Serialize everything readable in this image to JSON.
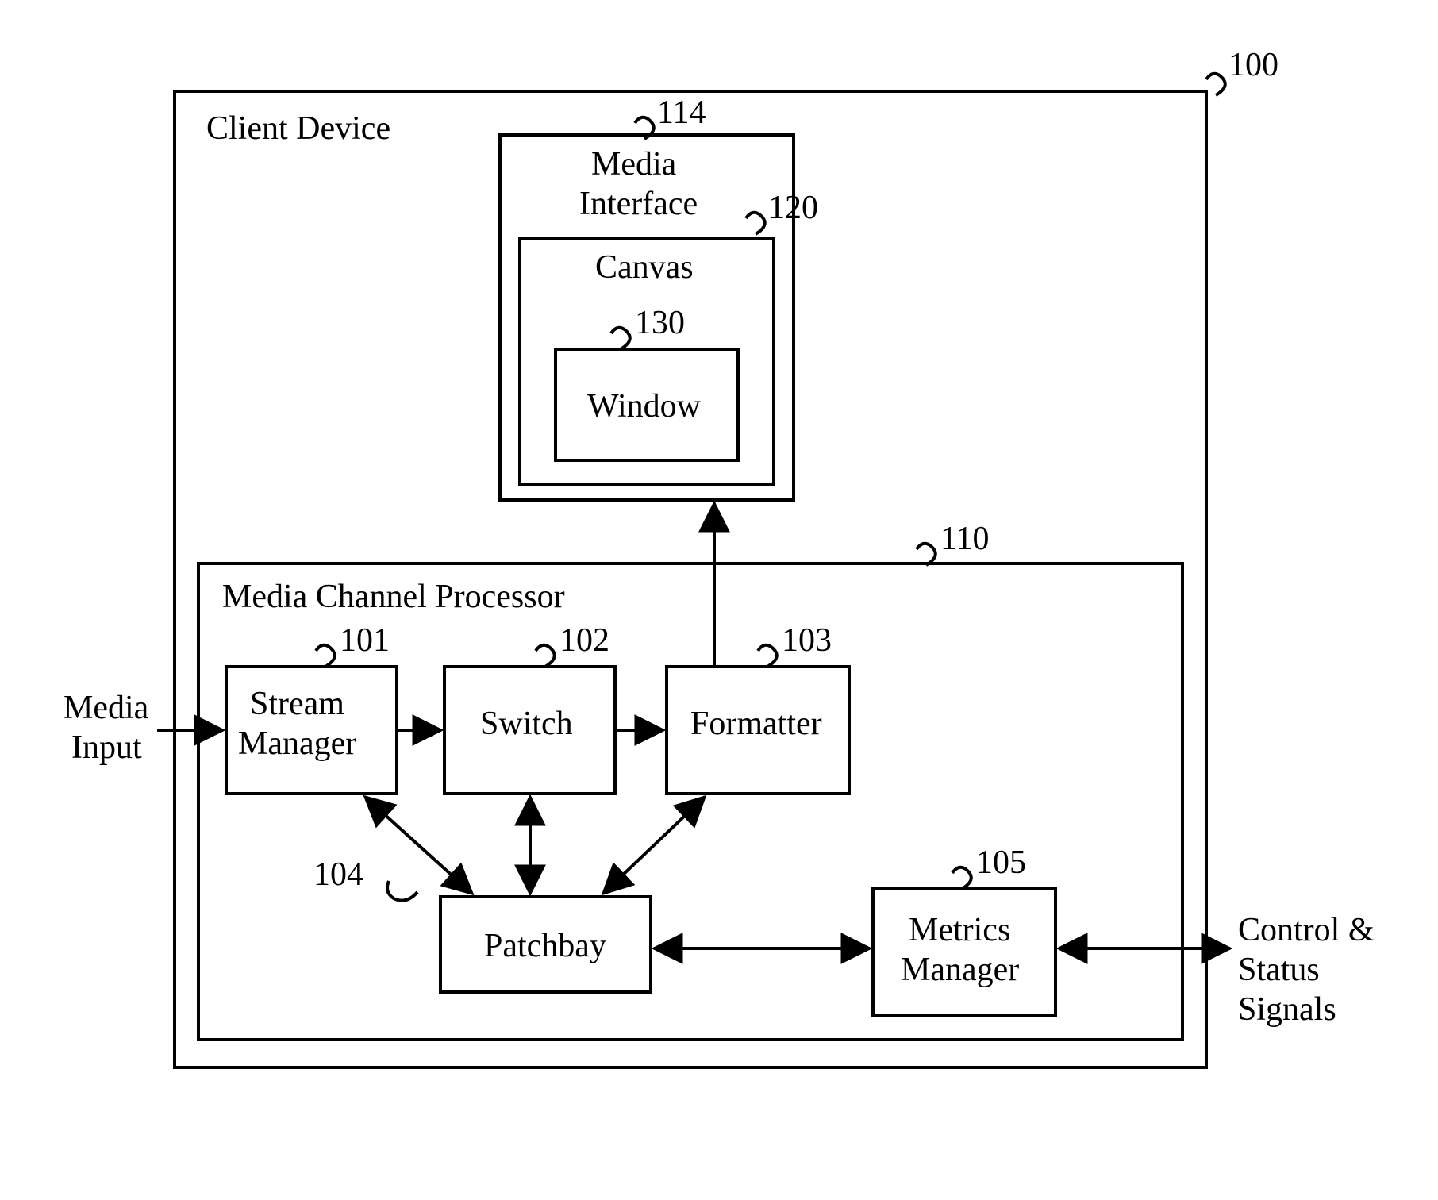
{
  "refs": {
    "client_device": "100",
    "media_interface": "114",
    "canvas": "120",
    "window": "130",
    "mcp": "110",
    "stream_manager": "101",
    "switch": "102",
    "formatter": "103",
    "patchbay": "104",
    "metrics_manager": "105"
  },
  "labels": {
    "client_device": "Client Device",
    "media_interface_l1": "Media",
    "media_interface_l2": "Interface",
    "canvas": "Canvas",
    "window": "Window",
    "mcp": "Media Channel Processor",
    "stream_manager_l1": "Stream",
    "stream_manager_l2": "Manager",
    "switch": "Switch",
    "formatter": "Formatter",
    "patchbay": "Patchbay",
    "metrics_manager_l1": "Metrics",
    "metrics_manager_l2": "Manager",
    "media_input_l1": "Media",
    "media_input_l2": "Input",
    "control_status_l1": "Control &",
    "control_status_l2": "Status",
    "control_status_l3": "Signals"
  }
}
